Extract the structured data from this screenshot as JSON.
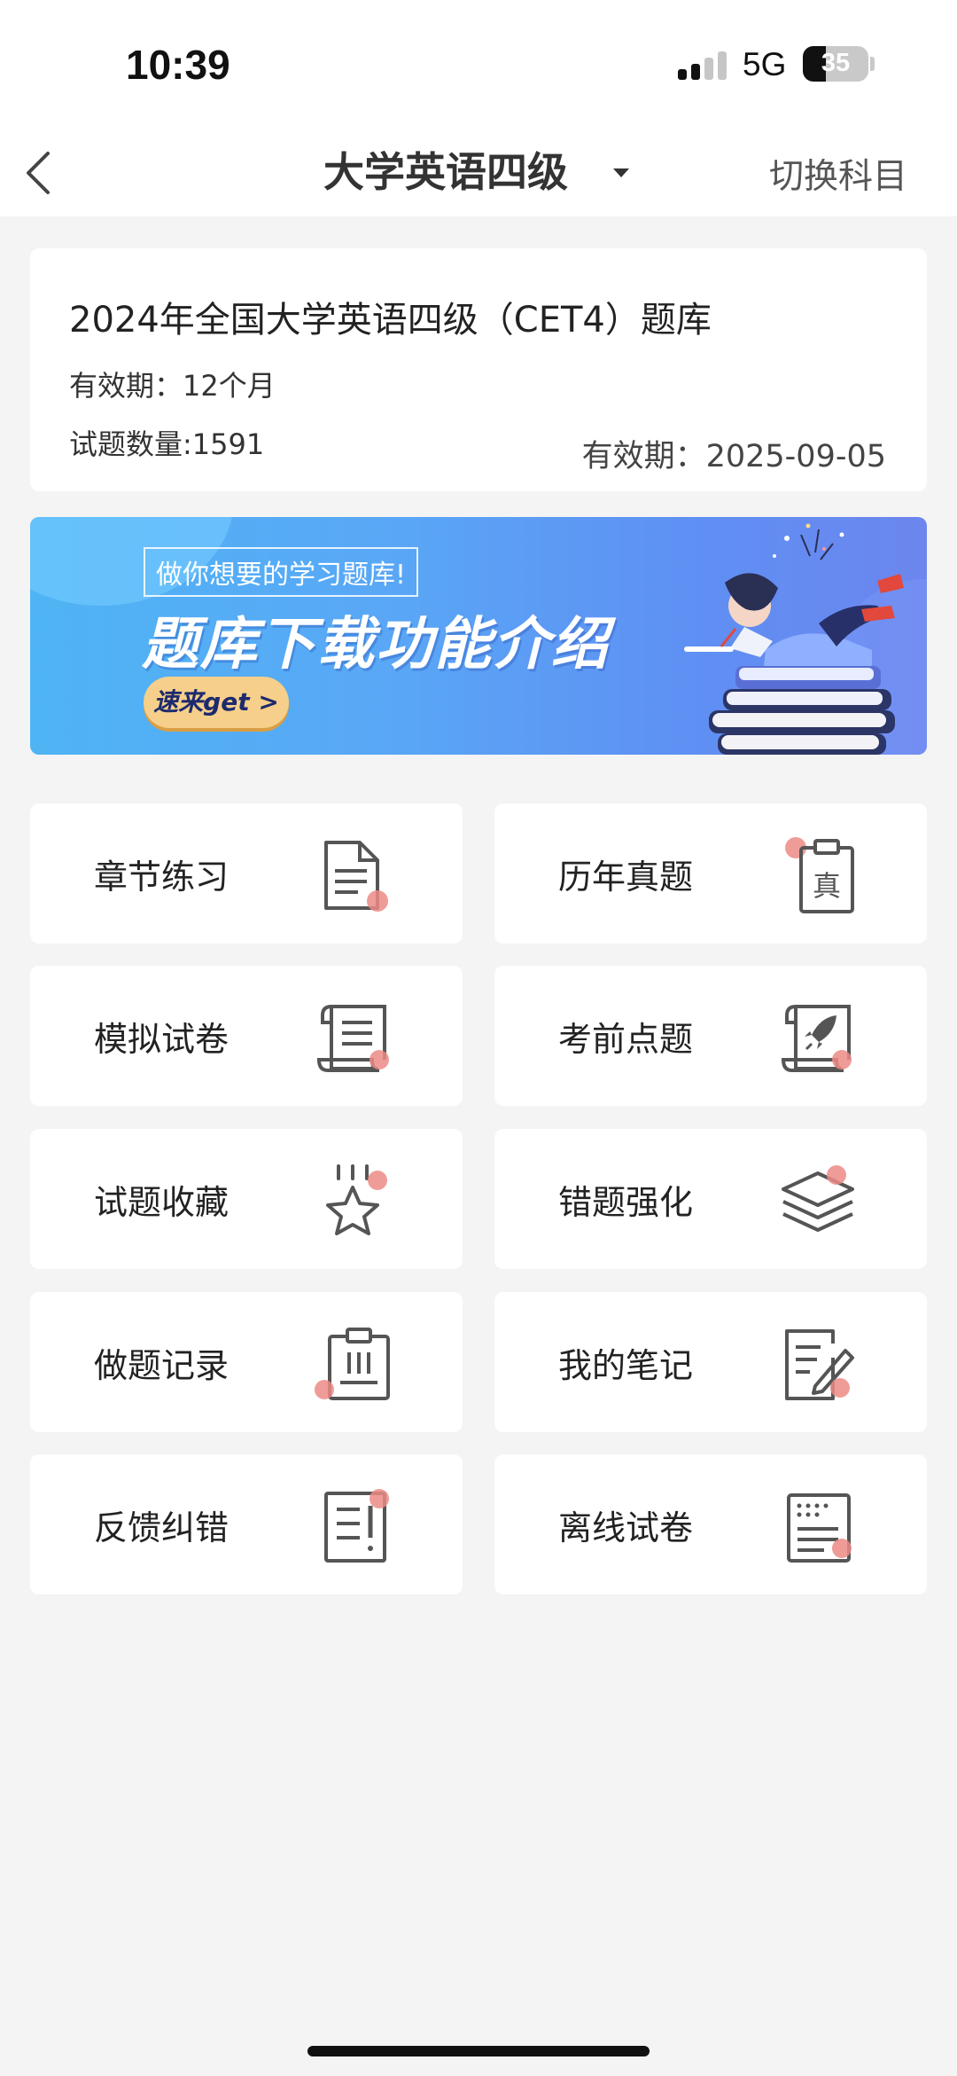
{
  "status_bar": {
    "time": "10:39",
    "network": "5G",
    "battery_level": "35",
    "battery_fraction": 0.35
  },
  "nav": {
    "title": "大学英语四级",
    "switch_label": "切换科目"
  },
  "info_card": {
    "title": "2024年全国大学英语四级（CET4）题库",
    "validity": "有效期：12个月",
    "question_count": "试题数量:1591",
    "expire_date": "有效期：2025-09-05"
  },
  "banner": {
    "tag": "做你想要的学习题库!",
    "title": "题库下载功能介绍",
    "button": "速来get >"
  },
  "menu": [
    {
      "label": "章节练习",
      "icon": "document-icon"
    },
    {
      "label": "历年真题",
      "icon": "clipboard-zhen-icon"
    },
    {
      "label": "模拟试卷",
      "icon": "scroll-icon"
    },
    {
      "label": "考前点题",
      "icon": "rocket-scroll-icon"
    },
    {
      "label": "试题收藏",
      "icon": "star-icon"
    },
    {
      "label": "错题强化",
      "icon": "layers-icon"
    },
    {
      "label": "做题记录",
      "icon": "record-clipboard-icon"
    },
    {
      "label": "我的笔记",
      "icon": "note-edit-icon"
    },
    {
      "label": "反馈纠错",
      "icon": "feedback-icon"
    },
    {
      "label": "离线试卷",
      "icon": "offline-paper-icon"
    }
  ],
  "colors": {
    "accent_dot": "#ec8b86",
    "icon_gray": "#555555",
    "page_bg": "#f4f4f4",
    "banner_start": "#4fb4f4",
    "banner_end": "#6c86ee"
  }
}
